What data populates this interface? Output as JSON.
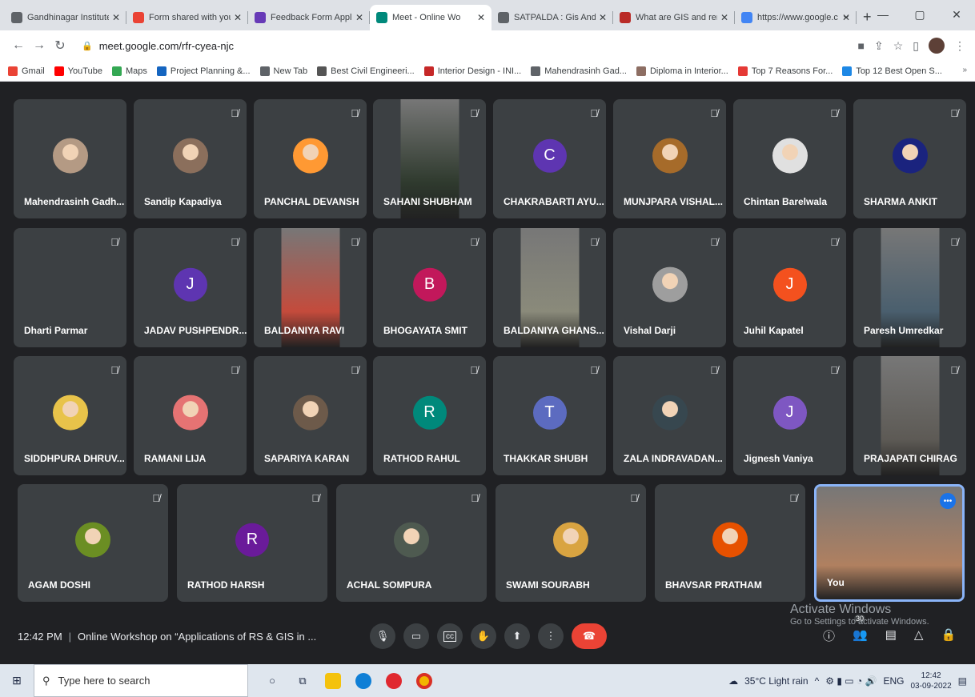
{
  "tabs": [
    {
      "title": "Gandhinagar Institute",
      "icon": "globe-icon",
      "color": "#5f6368",
      "active": false
    },
    {
      "title": "Form shared with you",
      "icon": "gmail-icon",
      "color": "#ea4335",
      "active": false
    },
    {
      "title": "Feedback Form Applic",
      "icon": "forms-icon",
      "color": "#673ab7",
      "active": false
    },
    {
      "title": "Meet - Online Wo",
      "icon": "meet-icon",
      "color": "#00897b",
      "active": true
    },
    {
      "title": "SATPALDA : Gis And R",
      "icon": "globe-icon",
      "color": "#5f6368",
      "active": false
    },
    {
      "title": "What are GIS and rem",
      "icon": "quora-icon",
      "color": "#b92b27",
      "active": false
    },
    {
      "title": "https://www.google.c",
      "icon": "google-icon",
      "color": "#4285f4",
      "active": false
    }
  ],
  "url": "meet.google.com/rfr-cyea-njc",
  "bookmarks": [
    {
      "label": "Gmail",
      "icon": "gmail-icon",
      "color": "#ea4335"
    },
    {
      "label": "YouTube",
      "icon": "youtube-icon",
      "color": "#ff0000"
    },
    {
      "label": "Maps",
      "icon": "maps-icon",
      "color": "#34a853"
    },
    {
      "label": "Project Planning &...",
      "icon": "s-icon",
      "color": "#1565c0"
    },
    {
      "label": "New Tab",
      "icon": "globe-icon",
      "color": "#5f6368"
    },
    {
      "label": "Best Civil Engineeri...",
      "icon": "gear-icon",
      "color": "#555"
    },
    {
      "label": "Interior Design - INI...",
      "icon": "pin-icon",
      "color": "#c62828"
    },
    {
      "label": "Mahendrasinh Gad...",
      "icon": "globe-icon",
      "color": "#5f6368"
    },
    {
      "label": "Diploma in Interior...",
      "icon": "srds-icon",
      "color": "#8d6e63"
    },
    {
      "label": "Top 7 Reasons For...",
      "icon": "red-icon",
      "color": "#e53935"
    },
    {
      "label": "Top 12 Best Open S...",
      "icon": "circle-icon",
      "color": "#1e88e5"
    }
  ],
  "participants": [
    {
      "name": "Mahendrasinh Gadh...",
      "type": "photo",
      "color": "#b49a84",
      "muted": false
    },
    {
      "name": "Sandip Kapadiya",
      "type": "photo",
      "color": "#8b6f5c",
      "muted": true
    },
    {
      "name": "PANCHAL DEVANSH",
      "type": "photo",
      "color": "#ff9933",
      "muted": true
    },
    {
      "name": "SAHANI SHUBHAM",
      "type": "video",
      "color": "#2f3a2e",
      "muted": true
    },
    {
      "name": "CHAKRABARTI AYU...",
      "type": "letter",
      "letter": "C",
      "color": "#5e35b1",
      "muted": true
    },
    {
      "name": "MUNJPARA VISHAL...",
      "type": "photo",
      "color": "#a66b2a",
      "muted": true
    },
    {
      "name": "Chintan Barelwala",
      "type": "photo",
      "color": "#e0e0e0",
      "muted": true
    },
    {
      "name": "SHARMA ANKIT",
      "type": "photo",
      "color": "#1a237e",
      "muted": true
    },
    {
      "name": "Dharti Parmar",
      "type": "blank",
      "color": "#3c4043",
      "muted": true
    },
    {
      "name": "JADAV PUSHPENDR...",
      "type": "letter",
      "letter": "J",
      "color": "#5e35b1",
      "muted": true
    },
    {
      "name": "BALDANIYA RAVI",
      "type": "video",
      "color": "#c44b3c",
      "muted": true
    },
    {
      "name": "BHOGAYATA SMIT",
      "type": "letter",
      "letter": "B",
      "color": "#c2185b",
      "muted": true
    },
    {
      "name": "BALDANIYA GHANS...",
      "type": "video",
      "color": "#8a8a7a",
      "muted": true
    },
    {
      "name": "Vishal Darji",
      "type": "photo",
      "color": "#9e9e9e",
      "muted": true
    },
    {
      "name": "Juhil Kapatel",
      "type": "letter",
      "letter": "J",
      "color": "#f4511e",
      "muted": true
    },
    {
      "name": "Paresh Umredkar",
      "type": "video",
      "color": "#4a5f6e",
      "muted": true
    },
    {
      "name": "SIDDHPURA DHRUV...",
      "type": "photo",
      "color": "#e8c34a",
      "muted": true
    },
    {
      "name": "RAMANI LIJA",
      "type": "photo",
      "color": "#e57373",
      "muted": true
    },
    {
      "name": "SAPARIYA KARAN",
      "type": "photo",
      "color": "#6d5a4a",
      "muted": true
    },
    {
      "name": "RATHOD RAHUL",
      "type": "letter",
      "letter": "R",
      "color": "#00897b",
      "muted": true
    },
    {
      "name": "THAKKAR SHUBH",
      "type": "letter",
      "letter": "T",
      "color": "#5c6bc0",
      "muted": true
    },
    {
      "name": "ZALA INDRAVADAN...",
      "type": "photo",
      "color": "#37474f",
      "muted": true
    },
    {
      "name": "Jignesh Vaniya",
      "type": "letter",
      "letter": "J",
      "color": "#7e57c2",
      "muted": true
    },
    {
      "name": "PRAJAPATI CHIRAG",
      "type": "video",
      "color": "#5d5a55",
      "muted": true
    },
    {
      "name": "AGAM DOSHI",
      "type": "photo",
      "color": "#6b8e23",
      "muted": true
    },
    {
      "name": "RATHOD HARSH",
      "type": "letter",
      "letter": "R",
      "color": "#6a1b9a",
      "muted": true
    },
    {
      "name": "ACHAL SOMPURA",
      "type": "photo",
      "color": "#4e5a50",
      "muted": true
    },
    {
      "name": "SWAMI SOURABH",
      "type": "photo",
      "color": "#d9a441",
      "muted": true
    },
    {
      "name": "BHAVSAR PRATHAM",
      "type": "photo",
      "color": "#e65100",
      "muted": true
    },
    {
      "name": "You",
      "type": "video",
      "color": "#b08060",
      "muted": false,
      "self": true
    }
  ],
  "meeting": {
    "time": "12:42 PM",
    "title": "Online Workshop on “Applications of RS & GIS in ..."
  },
  "people_count": "30",
  "watermark": {
    "line1": "Activate Windows",
    "line2": "Go to Settings to activate Windows."
  },
  "taskbar": {
    "search_placeholder": "Type here to search",
    "weather": "35°C  Light rain",
    "lang": "ENG",
    "time": "12:42",
    "date": "03-09-2022"
  }
}
